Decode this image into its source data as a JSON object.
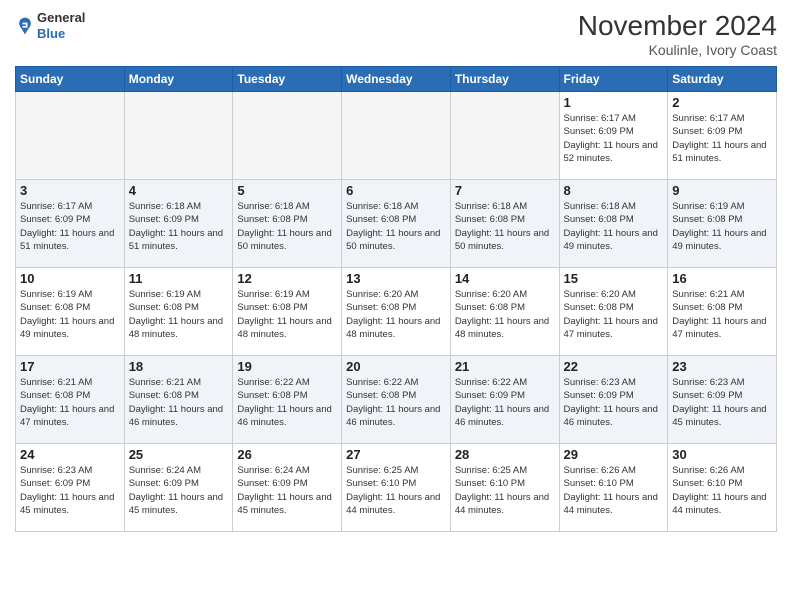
{
  "header": {
    "logo_line1": "General",
    "logo_line2": "Blue",
    "month": "November 2024",
    "location": "Koulinle, Ivory Coast"
  },
  "days_of_week": [
    "Sunday",
    "Monday",
    "Tuesday",
    "Wednesday",
    "Thursday",
    "Friday",
    "Saturday"
  ],
  "weeks": [
    [
      {
        "day": "",
        "info": ""
      },
      {
        "day": "",
        "info": ""
      },
      {
        "day": "",
        "info": ""
      },
      {
        "day": "",
        "info": ""
      },
      {
        "day": "",
        "info": ""
      },
      {
        "day": "1",
        "info": "Sunrise: 6:17 AM\nSunset: 6:09 PM\nDaylight: 11 hours and 52 minutes."
      },
      {
        "day": "2",
        "info": "Sunrise: 6:17 AM\nSunset: 6:09 PM\nDaylight: 11 hours and 51 minutes."
      }
    ],
    [
      {
        "day": "3",
        "info": "Sunrise: 6:17 AM\nSunset: 6:09 PM\nDaylight: 11 hours and 51 minutes."
      },
      {
        "day": "4",
        "info": "Sunrise: 6:18 AM\nSunset: 6:09 PM\nDaylight: 11 hours and 51 minutes."
      },
      {
        "day": "5",
        "info": "Sunrise: 6:18 AM\nSunset: 6:08 PM\nDaylight: 11 hours and 50 minutes."
      },
      {
        "day": "6",
        "info": "Sunrise: 6:18 AM\nSunset: 6:08 PM\nDaylight: 11 hours and 50 minutes."
      },
      {
        "day": "7",
        "info": "Sunrise: 6:18 AM\nSunset: 6:08 PM\nDaylight: 11 hours and 50 minutes."
      },
      {
        "day": "8",
        "info": "Sunrise: 6:18 AM\nSunset: 6:08 PM\nDaylight: 11 hours and 49 minutes."
      },
      {
        "day": "9",
        "info": "Sunrise: 6:19 AM\nSunset: 6:08 PM\nDaylight: 11 hours and 49 minutes."
      }
    ],
    [
      {
        "day": "10",
        "info": "Sunrise: 6:19 AM\nSunset: 6:08 PM\nDaylight: 11 hours and 49 minutes."
      },
      {
        "day": "11",
        "info": "Sunrise: 6:19 AM\nSunset: 6:08 PM\nDaylight: 11 hours and 48 minutes."
      },
      {
        "day": "12",
        "info": "Sunrise: 6:19 AM\nSunset: 6:08 PM\nDaylight: 11 hours and 48 minutes."
      },
      {
        "day": "13",
        "info": "Sunrise: 6:20 AM\nSunset: 6:08 PM\nDaylight: 11 hours and 48 minutes."
      },
      {
        "day": "14",
        "info": "Sunrise: 6:20 AM\nSunset: 6:08 PM\nDaylight: 11 hours and 48 minutes."
      },
      {
        "day": "15",
        "info": "Sunrise: 6:20 AM\nSunset: 6:08 PM\nDaylight: 11 hours and 47 minutes."
      },
      {
        "day": "16",
        "info": "Sunrise: 6:21 AM\nSunset: 6:08 PM\nDaylight: 11 hours and 47 minutes."
      }
    ],
    [
      {
        "day": "17",
        "info": "Sunrise: 6:21 AM\nSunset: 6:08 PM\nDaylight: 11 hours and 47 minutes."
      },
      {
        "day": "18",
        "info": "Sunrise: 6:21 AM\nSunset: 6:08 PM\nDaylight: 11 hours and 46 minutes."
      },
      {
        "day": "19",
        "info": "Sunrise: 6:22 AM\nSunset: 6:08 PM\nDaylight: 11 hours and 46 minutes."
      },
      {
        "day": "20",
        "info": "Sunrise: 6:22 AM\nSunset: 6:08 PM\nDaylight: 11 hours and 46 minutes."
      },
      {
        "day": "21",
        "info": "Sunrise: 6:22 AM\nSunset: 6:09 PM\nDaylight: 11 hours and 46 minutes."
      },
      {
        "day": "22",
        "info": "Sunrise: 6:23 AM\nSunset: 6:09 PM\nDaylight: 11 hours and 46 minutes."
      },
      {
        "day": "23",
        "info": "Sunrise: 6:23 AM\nSunset: 6:09 PM\nDaylight: 11 hours and 45 minutes."
      }
    ],
    [
      {
        "day": "24",
        "info": "Sunrise: 6:23 AM\nSunset: 6:09 PM\nDaylight: 11 hours and 45 minutes."
      },
      {
        "day": "25",
        "info": "Sunrise: 6:24 AM\nSunset: 6:09 PM\nDaylight: 11 hours and 45 minutes."
      },
      {
        "day": "26",
        "info": "Sunrise: 6:24 AM\nSunset: 6:09 PM\nDaylight: 11 hours and 45 minutes."
      },
      {
        "day": "27",
        "info": "Sunrise: 6:25 AM\nSunset: 6:10 PM\nDaylight: 11 hours and 44 minutes."
      },
      {
        "day": "28",
        "info": "Sunrise: 6:25 AM\nSunset: 6:10 PM\nDaylight: 11 hours and 44 minutes."
      },
      {
        "day": "29",
        "info": "Sunrise: 6:26 AM\nSunset: 6:10 PM\nDaylight: 11 hours and 44 minutes."
      },
      {
        "day": "30",
        "info": "Sunrise: 6:26 AM\nSunset: 6:10 PM\nDaylight: 11 hours and 44 minutes."
      }
    ]
  ]
}
